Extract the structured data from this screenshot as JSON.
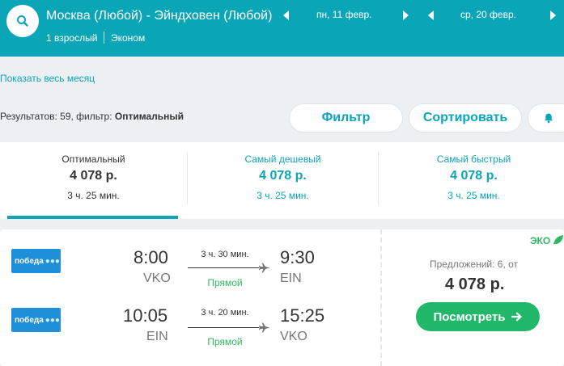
{
  "header": {
    "route": "Москва (Любой) - Эйндховен (Любой)",
    "depart_date": "пн, 11 февр.",
    "return_date": "ср, 20 февр.",
    "passengers": "1 взрослый",
    "cabin": "Эконом"
  },
  "links": {
    "show_month": "Показать весь месяц"
  },
  "results": {
    "prefix": "Результатов: 59, фильтр: ",
    "filter": "Оптимальный"
  },
  "buttons": {
    "filter": "Фильтр",
    "sort": "Сортировать"
  },
  "tabs": [
    {
      "title": "Оптимальный",
      "price": "4 078 р.",
      "duration": "3 ч. 25 мин."
    },
    {
      "title": "Самый дешевый",
      "price": "4 078 р.",
      "duration": "3 ч. 25 мин."
    },
    {
      "title": "Самый быстрый",
      "price": "4 078 р.",
      "duration": "3 ч. 25 мин."
    }
  ],
  "ticket": {
    "segments": [
      {
        "airline": "победа",
        "dep_time": "8:00",
        "dep_code": "VKO",
        "arr_time": "9:30",
        "arr_code": "EIN",
        "duration": "3 ч. 30 мин.",
        "type": "Прямой"
      },
      {
        "airline": "победа",
        "dep_time": "10:05",
        "dep_code": "EIN",
        "arr_time": "15:25",
        "arr_code": "VKO",
        "duration": "3 ч. 20 мин.",
        "type": "Прямой"
      }
    ],
    "eco": "ЭКО",
    "offers": "Предложений: 6, от",
    "price": "4 078 р.",
    "view_button": "Посмотреть"
  },
  "colors": {
    "accent": "#0ba5b8",
    "green": "#22b86a",
    "airline_blue": "#1e8fd9"
  }
}
